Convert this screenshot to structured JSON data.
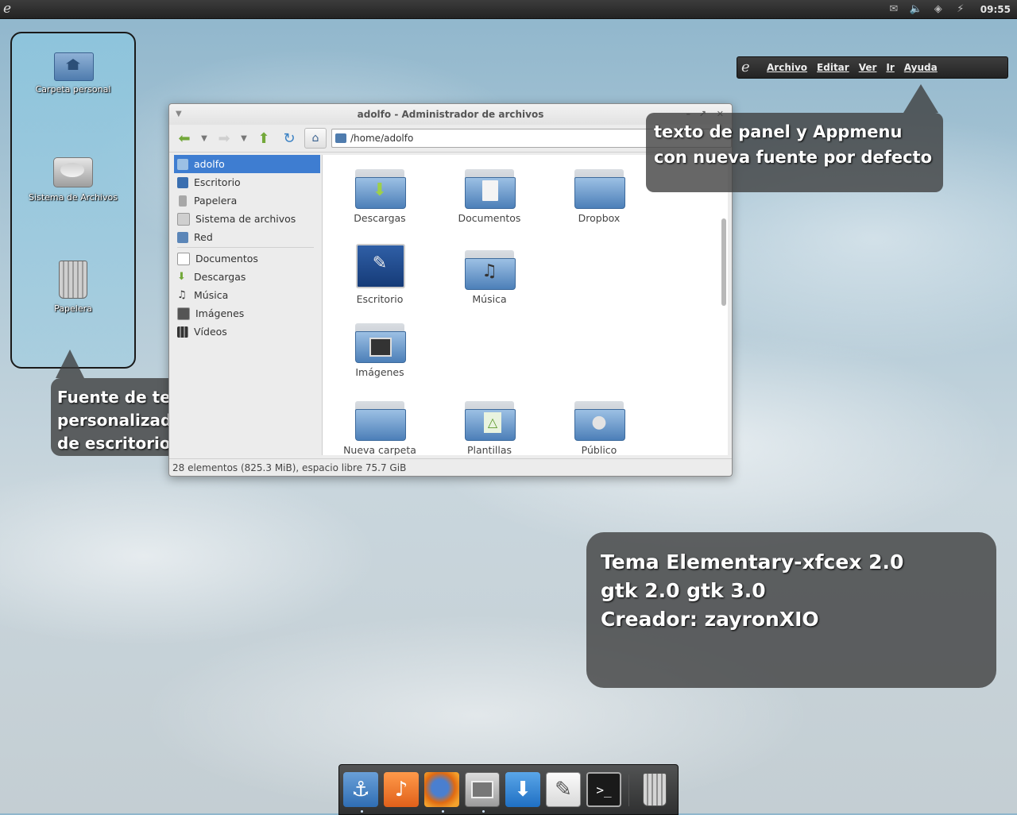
{
  "top_panel": {
    "clock": "09:55",
    "tray_icons": [
      "mail-icon",
      "volume-icon",
      "dropbox-icon",
      "network-icon"
    ]
  },
  "desktop_icons": [
    {
      "label": "Carpeta personal",
      "icon": "home-folder-icon"
    },
    {
      "label": "Sistema de Archivos",
      "icon": "drive-icon"
    },
    {
      "label": "Papelera",
      "icon": "trash-icon"
    }
  ],
  "callouts": {
    "desktop_font": "Fuente de texto personalizada para iconos de escritorio",
    "panel_font": "texto de panel y Appmenu con nueva fuente por defecto",
    "theme_line1": "Tema Elementary-xfcex 2.0",
    "theme_line2": "gtk 2.0 gtk 3.0",
    "theme_line3": "Creador: zayronXIO"
  },
  "appmenu": {
    "items": [
      "Archivo",
      "Editar",
      "Ver",
      "Ir",
      "Ayuda"
    ]
  },
  "file_manager": {
    "title": "adolfo - Administrador de archivos",
    "path": "/home/adolfo",
    "sidebar": [
      {
        "label": "adolfo",
        "selected": true
      },
      {
        "label": "Escritorio"
      },
      {
        "label": "Papelera"
      },
      {
        "label": "Sistema de archivos"
      },
      {
        "label": "Red"
      },
      {
        "label": "Documentos"
      },
      {
        "label": "Descargas"
      },
      {
        "label": "Música"
      },
      {
        "label": "Imágenes"
      },
      {
        "label": "Vídeos"
      }
    ],
    "files": [
      {
        "label": "Descargas"
      },
      {
        "label": "Documentos"
      },
      {
        "label": "Dropbox"
      },
      {
        "label": "Escritorio"
      },
      {
        "label": "Música"
      },
      {
        "label": "Imágenes"
      },
      {
        "label": "Nueva carpeta"
      },
      {
        "label": "Plantillas"
      },
      {
        "label": "Público"
      }
    ],
    "status": "28 elementos (825.3 MiB), espacio libre 75.7 GiB"
  },
  "dock": {
    "items": [
      "anchor-icon",
      "music-note-icon",
      "firefox-icon",
      "file-manager-icon",
      "download-icon",
      "text-editor-icon",
      "terminal-icon",
      "trash-icon"
    ]
  },
  "colors": {
    "selection": "#3e7dd1",
    "panel": "#2e2e2e",
    "callout": "#3c3c3c"
  }
}
